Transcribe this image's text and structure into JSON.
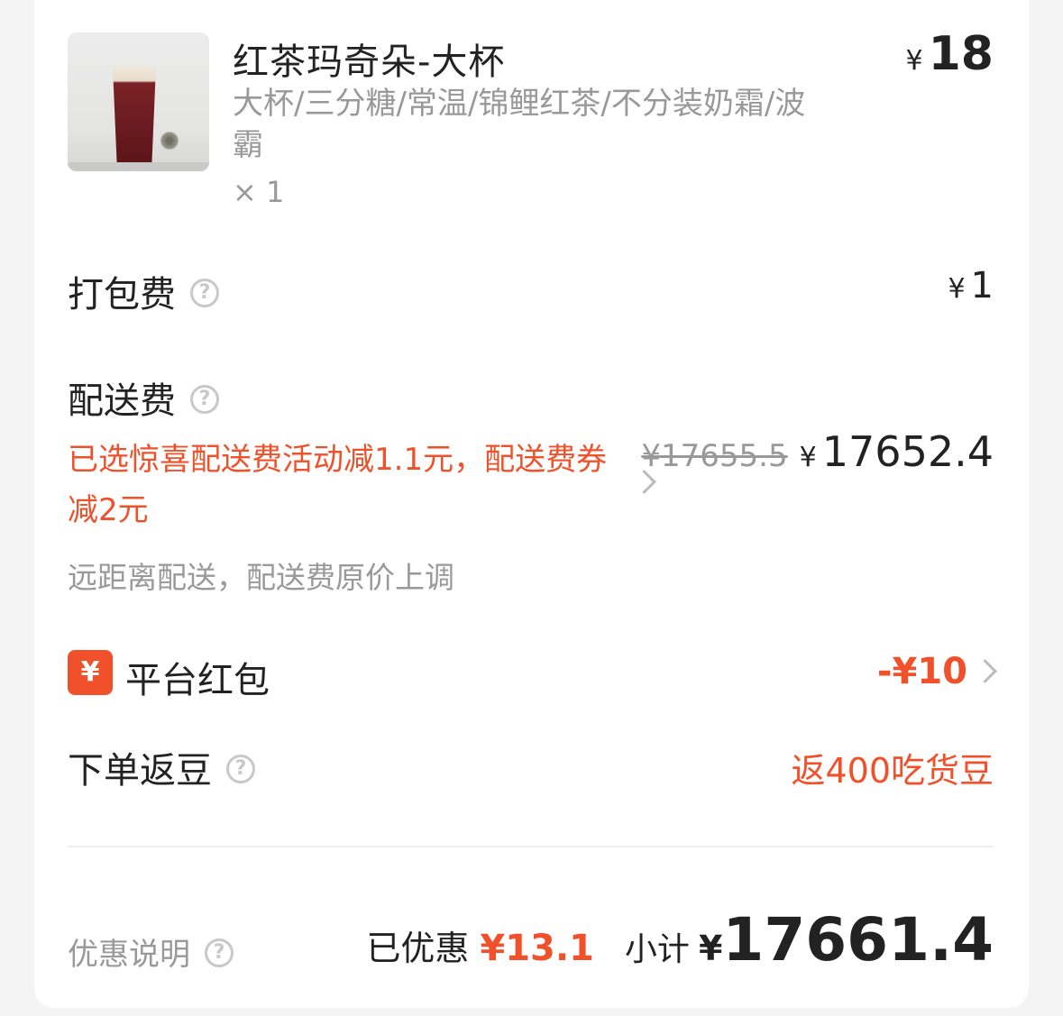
{
  "product": {
    "name": "红茶玛奇朵-大杯",
    "spec": "大杯/三分糖/常温/锦鲤红茶/不分装奶霜/波霸",
    "qty": "× 1",
    "price_symbol": "¥",
    "price": "18"
  },
  "packing_fee": {
    "label": "打包费",
    "symbol": "¥",
    "value": "1"
  },
  "delivery_fee": {
    "label": "配送费",
    "promo": "已选惊喜配送费活动减1.1元，配送费券减2元",
    "note": "远距离配送，配送费原价上调",
    "original_price": "¥17655.5",
    "symbol": "¥",
    "price": "17652.4"
  },
  "red_packet": {
    "icon_glyph": "¥",
    "label": "平台红包",
    "value": "-¥10"
  },
  "beans": {
    "label": "下单返豆",
    "value": "返400吃货豆"
  },
  "summary": {
    "discount_label": "优惠说明",
    "saved_label": "已优惠",
    "saved_value": "¥13.1",
    "subtotal_label": "小计",
    "subtotal_symbol": "¥",
    "subtotal_value": "17661.4"
  },
  "colors": {
    "accent": "#f0512b",
    "muted": "#999999"
  }
}
